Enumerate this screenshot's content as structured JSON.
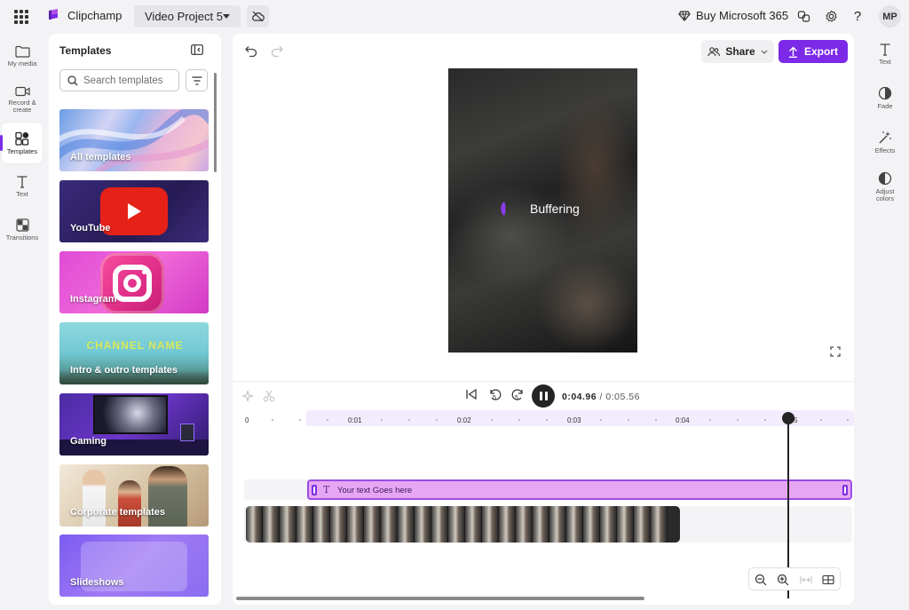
{
  "app": {
    "name": "Clipchamp",
    "project_name": "Video Project 5",
    "buy_label": "Buy Microsoft 365",
    "avatar_initials": "MP",
    "accent_color": "#7c2ae8"
  },
  "left_rail": {
    "items": [
      {
        "label": "My media",
        "icon": "folder-icon"
      },
      {
        "label": "Record & create",
        "icon": "camera-icon"
      },
      {
        "label": "Templates",
        "icon": "templates-icon",
        "active": true
      },
      {
        "label": "Text",
        "icon": "text-icon"
      },
      {
        "label": "Transitions",
        "icon": "transitions-icon"
      }
    ]
  },
  "templates_panel": {
    "title": "Templates",
    "search_placeholder": "Search templates",
    "cards": [
      {
        "label": "All templates"
      },
      {
        "label": "YouTube"
      },
      {
        "label": "Instagram"
      },
      {
        "label": "Intro & outro templates",
        "art_text": "CHANNEL NAME"
      },
      {
        "label": "Gaming"
      },
      {
        "label": "Corporate templates"
      },
      {
        "label": "Slideshows"
      }
    ]
  },
  "toolbar": {
    "share_label": "Share",
    "export_label": "Export"
  },
  "preview": {
    "status_text": "Buffering"
  },
  "playback": {
    "current_time": "0:04.96",
    "separator": "/",
    "duration": "0:05.56",
    "skip_back_seconds": "5",
    "skip_forward_seconds": "5"
  },
  "timeline": {
    "ticks": [
      "0",
      "0:01",
      "0:02",
      "0:03",
      "0:04",
      "5"
    ],
    "text_clip_label": "Your text Goes here",
    "frame_count": 25
  },
  "right_rail": {
    "items": [
      {
        "label": "Text",
        "icon": "text-icon"
      },
      {
        "label": "Fade",
        "icon": "fade-icon"
      },
      {
        "label": "Effects",
        "icon": "effects-icon"
      },
      {
        "label": "Adjust colors",
        "icon": "adjust-colors-icon"
      }
    ]
  }
}
